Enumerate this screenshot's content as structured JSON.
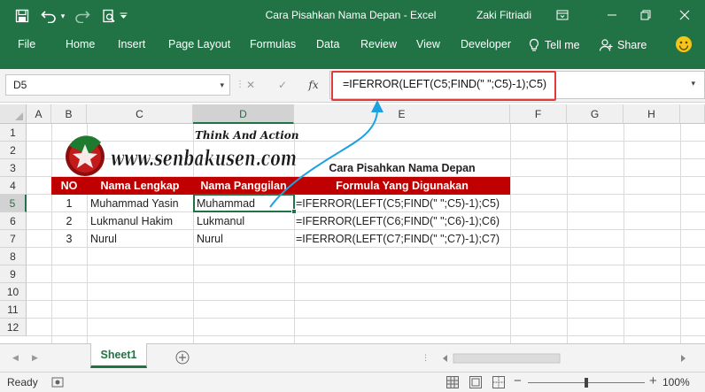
{
  "window": {
    "title": "Cara Pisahkan Nama Depan  -  Excel",
    "user": "Zaki Fitriadi"
  },
  "ribbon": {
    "tabs": [
      "File",
      "Home",
      "Insert",
      "Page Layout",
      "Formulas",
      "Data",
      "Review",
      "View",
      "Developer"
    ],
    "tell_me": "Tell me",
    "share": "Share"
  },
  "formula_bar": {
    "name_box": "D5",
    "cancel_symbol": "✕",
    "enter_symbol": "✓",
    "fx_label": "fx",
    "formula": "=IFERROR(LEFT(C5;FIND(\" \";C5)-1);C5)"
  },
  "grid": {
    "columns": [
      "A",
      "B",
      "C",
      "D",
      "E",
      "F",
      "G",
      "H"
    ],
    "rows": [
      "1",
      "2",
      "3",
      "4",
      "5",
      "6",
      "7",
      "8",
      "9",
      "10",
      "11",
      "12"
    ],
    "active_cell": "D5"
  },
  "sheet": {
    "logo_text": "www.senbakusen.com",
    "logo_tagline": "Think And Action",
    "title": "Cara Pisahkan Nama Depan",
    "headers": {
      "no": "NO",
      "full_name": "Nama Lengkap",
      "nickname": "Nama Panggilan",
      "formula": "Formula Yang Digunakan"
    },
    "rows": [
      {
        "no": "1",
        "full_name": "Muhammad Yasin",
        "nickname": "Muhammad",
        "formula": "=IFERROR(LEFT(C5;FIND(\" \";C5)-1);C5)"
      },
      {
        "no": "2",
        "full_name": "Lukmanul Hakim",
        "nickname": "Lukmanul",
        "formula": "=IFERROR(LEFT(C6;FIND(\" \";C6)-1);C6)"
      },
      {
        "no": "3",
        "full_name": "Nurul",
        "nickname": "Nurul",
        "formula": "=IFERROR(LEFT(C7;FIND(\" \";C7)-1);C7)"
      }
    ]
  },
  "sheet_tabs": [
    "Sheet1"
  ],
  "status": {
    "ready": "Ready",
    "zoom_minus": "−",
    "zoom_plus": "+",
    "zoom": "100%"
  },
  "colors": {
    "excel_green": "#217346",
    "header_red": "#c00000",
    "highlight_red": "#e23a3a",
    "arrow_blue": "#1ea1e0"
  }
}
